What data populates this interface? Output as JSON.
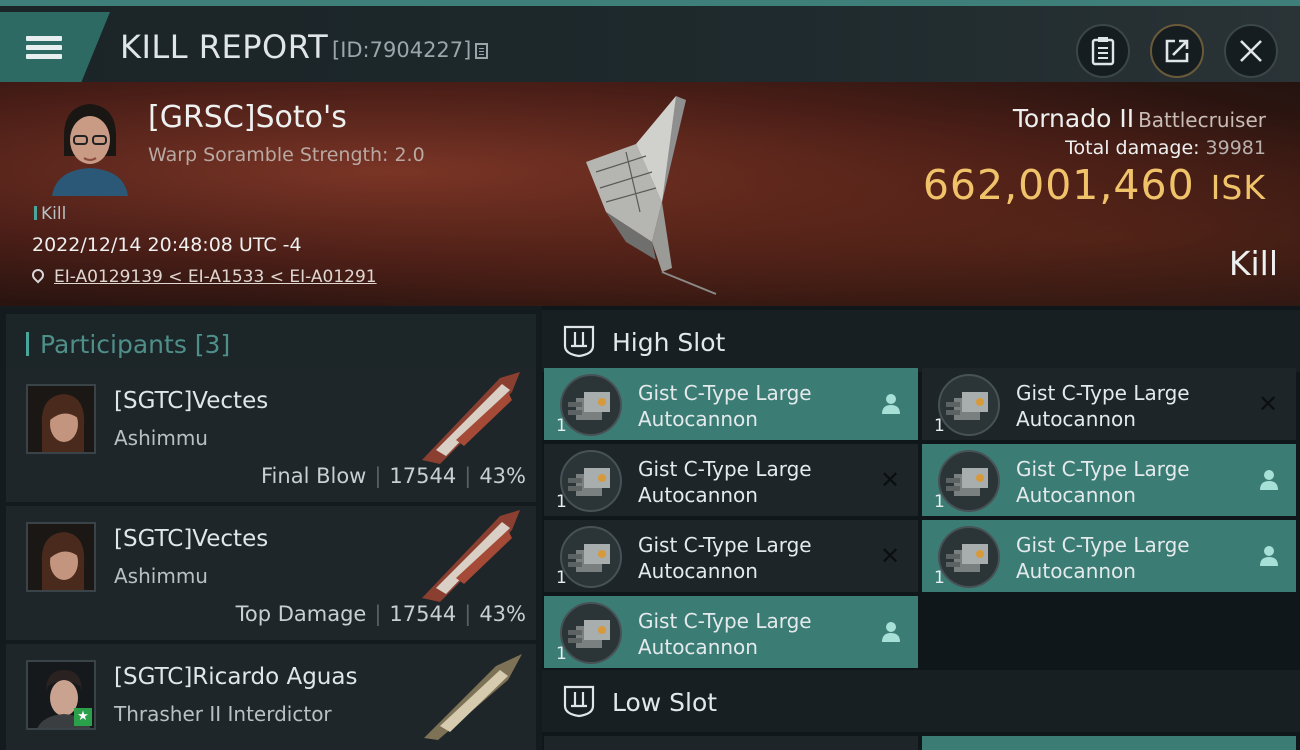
{
  "header": {
    "title": "KILL REPORT",
    "id_text": "[ID:7904227]"
  },
  "victim": {
    "name": "[GRSC]Soto's",
    "subtitle": "Warp Soramble Strength: 2.0",
    "kill_tag": "Kill",
    "datetime": "2022/12/14 20:48:08 UTC -4",
    "location": "EI-A0129139 < EI-A1533 < EI-A01291",
    "ship_name": "Tornado II",
    "ship_class": "Battlecruiser",
    "total_damage_label": "Total damage:",
    "total_damage_value": "39981",
    "isk_value": "662,001,460",
    "isk_unit": "ISK",
    "result": "Kill"
  },
  "participants": {
    "header": "Participants [3]",
    "items": [
      {
        "name": "[SGTC]Vectes",
        "ship": "Ashimmu",
        "role": "Final Blow",
        "damage": "17544",
        "percent": "43%"
      },
      {
        "name": "[SGTC]Vectes",
        "ship": "Ashimmu",
        "role": "Top Damage",
        "damage": "17544",
        "percent": "43%"
      },
      {
        "name": "[SGTC]Ricardo Aguas",
        "ship": "Thrasher II Interdictor"
      }
    ]
  },
  "fitting": {
    "high_slot_label": "High Slot",
    "low_slot_label": "Low Slot",
    "high_slot": [
      {
        "line1": "Gist C-Type Large",
        "line2": "Autocannon",
        "qty": "1",
        "status": "dropped"
      },
      {
        "line1": "Gist C-Type Large",
        "line2": "Autocannon",
        "qty": "1",
        "status": "destroyed"
      },
      {
        "line1": "Gist C-Type Large",
        "line2": "Autocannon",
        "qty": "1",
        "status": "destroyed"
      },
      {
        "line1": "Gist C-Type Large",
        "line2": "Autocannon",
        "qty": "1",
        "status": "dropped"
      },
      {
        "line1": "Gist C-Type Large",
        "line2": "Autocannon",
        "qty": "1",
        "status": "destroyed"
      },
      {
        "line1": "Gist C-Type Large",
        "line2": "Autocannon",
        "qty": "1",
        "status": "dropped"
      },
      {
        "line1": "Gist C-Type Large",
        "line2": "Autocannon",
        "qty": "1",
        "status": "dropped"
      }
    ]
  },
  "colors": {
    "accent": "#3b7c74",
    "isk": "#f0c36a",
    "banner": "#4a1e17"
  }
}
